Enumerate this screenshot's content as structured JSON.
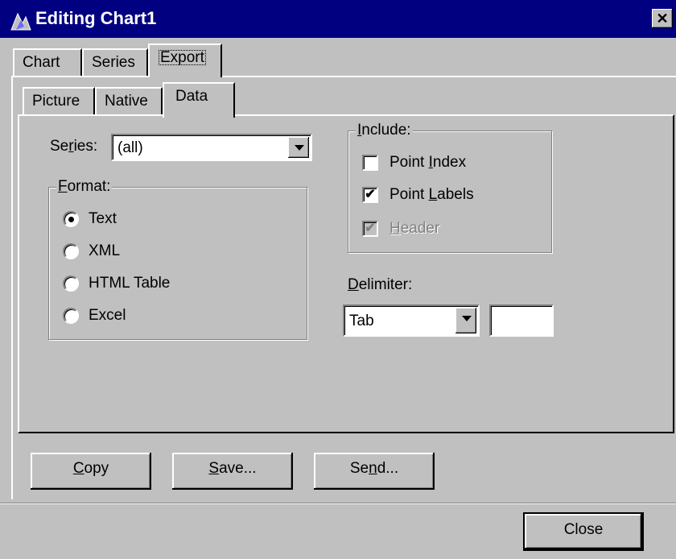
{
  "window": {
    "title": "Editing Chart1",
    "close_glyph": "✕",
    "icon": "chart-app-icon"
  },
  "outer_tabs": [
    "Chart",
    "Series",
    "Export"
  ],
  "inner_tabs": [
    "Picture",
    "Native",
    "Data"
  ],
  "series": {
    "label": "Series:",
    "value": "(all)"
  },
  "format": {
    "label": "Format:",
    "options": [
      "Text",
      "XML",
      "HTML Table",
      "Excel"
    ],
    "selected": "Text"
  },
  "include": {
    "label": "Include:",
    "point_index": {
      "label": "Point Index",
      "checked": false
    },
    "point_labels": {
      "label": "Point Labels",
      "checked": true
    },
    "header": {
      "label": "Header",
      "checked": true,
      "disabled": true
    }
  },
  "delimiter": {
    "label": "Delimiter:",
    "value": "Tab",
    "custom_value": ""
  },
  "buttons": {
    "copy": "Copy",
    "save": "Save...",
    "send": "Send...",
    "close": "Close"
  },
  "check_glyph": "✔"
}
